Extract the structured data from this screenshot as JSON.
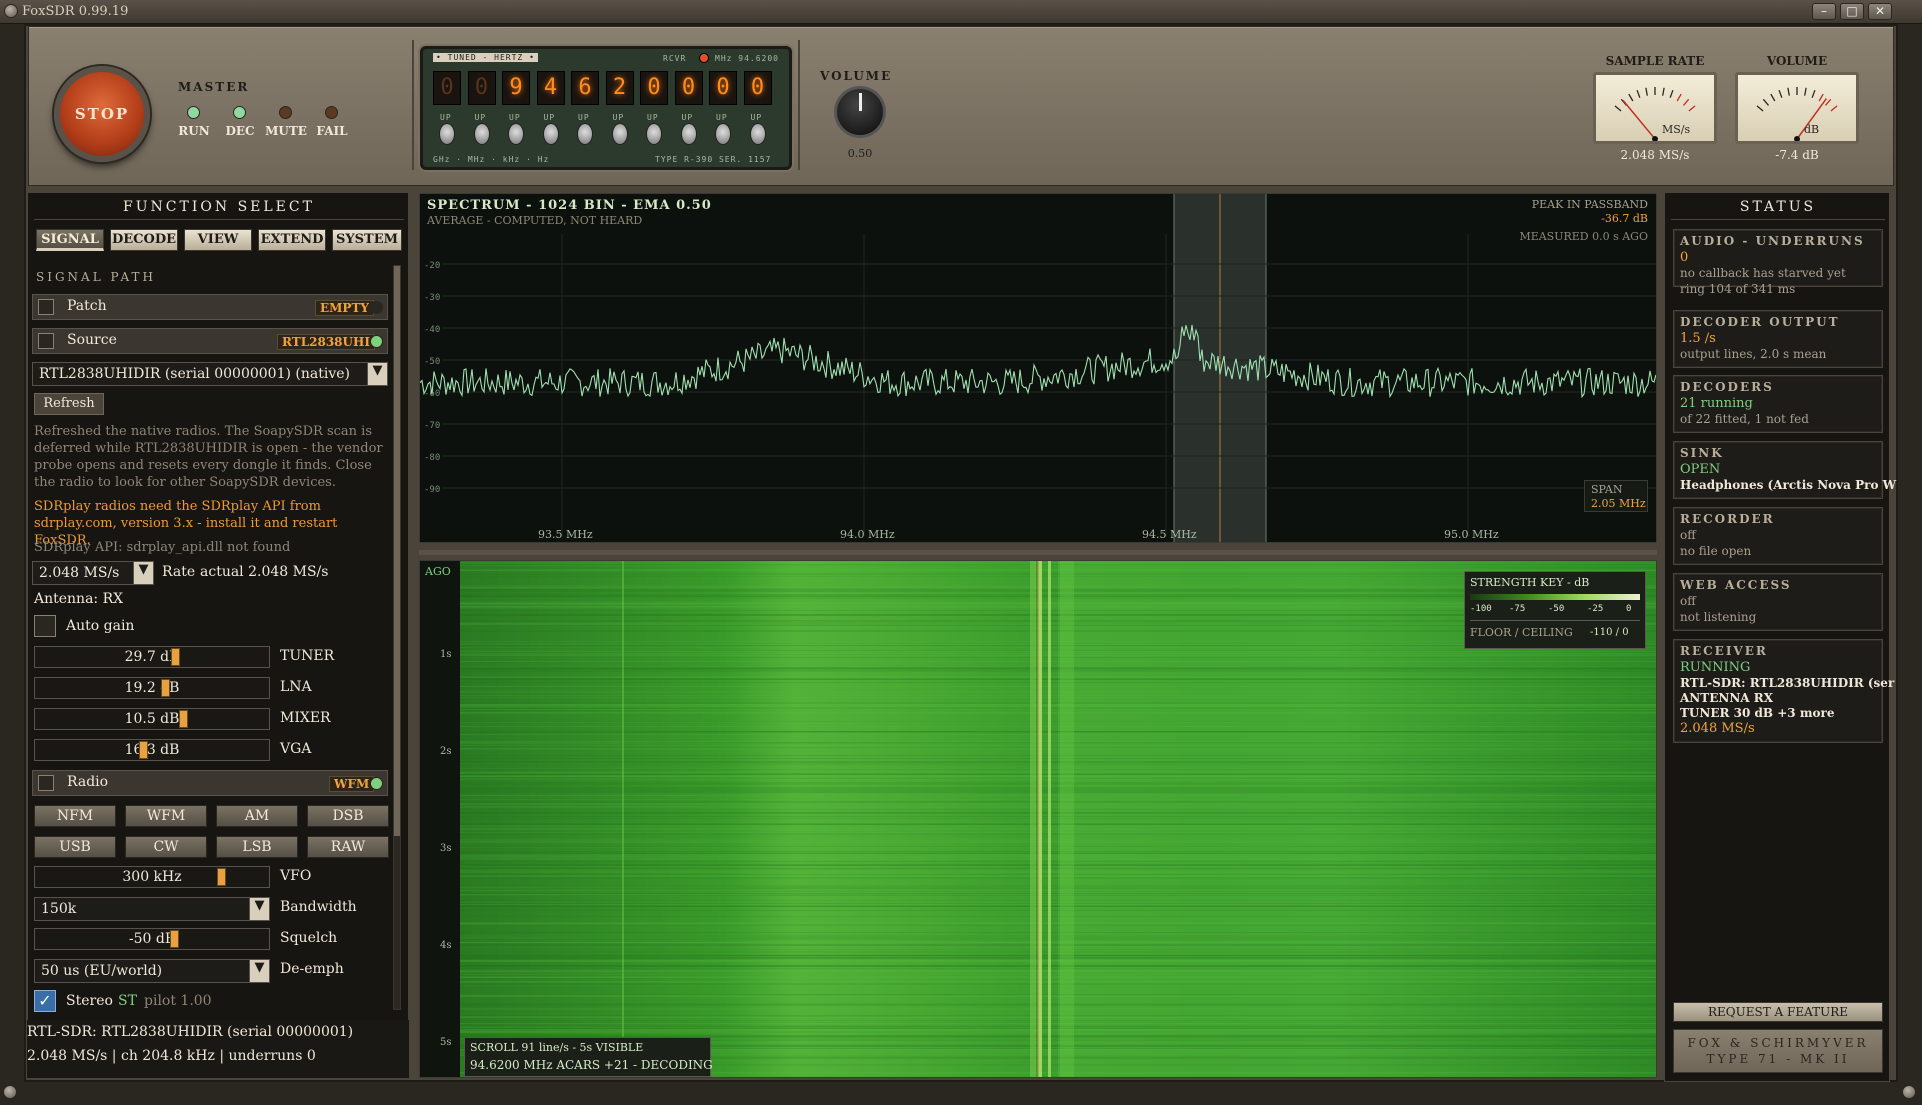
{
  "window": {
    "title": "FoxSDR 0.99.19"
  },
  "top": {
    "stop_label": "STOP",
    "master_label": "MASTER",
    "leds": [
      {
        "label": "RUN",
        "color": "#8fd8a0"
      },
      {
        "label": "DEC",
        "color": "#8fd8a0"
      },
      {
        "label": "MUTE",
        "color": "#5a3a20"
      },
      {
        "label": "FAIL",
        "color": "#5a3a20"
      }
    ],
    "freq": {
      "header_left": "• TUNED - HERTZ •",
      "header_right": "RCVR",
      "header_mhz": "MHz 94.6200",
      "digits": [
        "0",
        "0",
        "9",
        "4",
        "6",
        "2",
        "0",
        "0",
        "0",
        "0"
      ],
      "dim_count": 2,
      "toggle_label": "UP",
      "footer_left": "GHz · MHz · kHz · Hz",
      "footer_right": "TYPE R-390  SER. 1157"
    },
    "volume_knob": {
      "label": "VOLUME",
      "value": "0.50"
    },
    "meters": [
      {
        "title": "SAMPLE RATE",
        "unit": "MS/s",
        "value": "2.048 MS/s"
      },
      {
        "title": "VOLUME",
        "unit": "dB",
        "value": "-7.4 dB"
      }
    ]
  },
  "left": {
    "title": "FUNCTION SELECT",
    "tabs": [
      "SIGNAL",
      "DECODE",
      "VIEW",
      "EXTEND",
      "SYSTEM"
    ],
    "active_tab": 0,
    "signal_path_label": "SIGNAL PATH",
    "patch": {
      "label": "Patch",
      "tag": "EMPTY"
    },
    "source": {
      "label": "Source",
      "tag": "RTL2838UHI"
    },
    "device": "RTL2838UHIDIR (serial 00000001) (native)",
    "refresh_label": "Refresh",
    "note1": "Refreshed the native radios. The SoapySDR scan is deferred while RTL2838UHIDIR is open - the vendor probe opens and resets every dongle it finds. Close the radio to look for other SoapySDR devices.",
    "warn1": "SDRplay radios need the SDRplay API from sdrplay.com, version 3.x - install it and restart FoxSDR.",
    "note2": "SDRplay API: sdrplay_api.dll not found",
    "rate_value": "2.048 MS/s",
    "rate_label": "Rate",
    "rate_actual": "actual 2.048 MS/s",
    "antenna": "Antenna: RX",
    "auto_gain": "Auto gain",
    "gains": [
      {
        "value": "29.7 dB",
        "label": "TUNER",
        "level": 0.68
      },
      {
        "value": "19.2 dB",
        "label": "LNA",
        "level": 0.63
      },
      {
        "value": "10.5 dB",
        "label": "MIXER",
        "level": 0.72
      },
      {
        "value": "16.3 dB",
        "label": "VGA",
        "level": 0.52
      }
    ],
    "radio": {
      "label": "Radio",
      "tag": "WFM"
    },
    "modes": [
      "NFM",
      "WFM",
      "AM",
      "DSB",
      "USB",
      "CW",
      "LSB",
      "RAW"
    ],
    "vfo": {
      "value": "300 kHz",
      "label": "VFO",
      "level": 0.8
    },
    "bandwidth": {
      "value": "150k",
      "label": "Bandwidth"
    },
    "squelch": {
      "value": "-50 dB",
      "label": "Squelch",
      "level": 0.6
    },
    "deemph": {
      "value": "50 us (EU/world)",
      "label": "De-emph"
    },
    "stereo": {
      "label": "Stereo",
      "st": "ST",
      "pilot": "pilot 1.00"
    },
    "status_line1": "RTL-SDR: RTL2838UHIDIR (serial 00000001)",
    "status_line2": "2.048 MS/s | ch 204.8 kHz | underruns 0"
  },
  "spectrum": {
    "title": "SPECTRUM - 1024 BIN - EMA 0.50",
    "subtitle": "AVERAGE - COMPUTED, NOT HEARD",
    "peak_label": "PEAK IN PASSBAND",
    "peak_value": "-36.7 dB",
    "measured": "MEASURED 0.0 s AGO",
    "span_label": "SPAN",
    "span_value": "2.05 MHz",
    "y_ticks": [
      "-20",
      "-30",
      "-40",
      "-50",
      "-60",
      "-70",
      "-80",
      "-90"
    ],
    "x_ticks": [
      "93.5 MHz",
      "94.0 MHz",
      "94.5 MHz",
      "95.0 MHz"
    ]
  },
  "waterfall": {
    "ago_label": "AGO",
    "time_ticks": [
      "1s",
      "2s",
      "3s",
      "4s",
      "5s"
    ],
    "key_title": "STRENGTH KEY - dB",
    "key_ticks": [
      "-100",
      "-75",
      "-50",
      "-25",
      "0"
    ],
    "floor_label": "FLOOR / CEILING",
    "floor_value": "-110 / 0",
    "scroll_line": "SCROLL 91 line/s  -  5s VISIBLE",
    "decode_line": "94.6200 MHz ACARS +21 - DECODING"
  },
  "status": {
    "title": "STATUS",
    "cards": [
      {
        "h": "AUDIO - UNDERRUNS",
        "v": "0",
        "d1": "no callback has starved yet",
        "d2": "ring 104 of 341 ms"
      },
      {
        "h": "DECODER OUTPUT",
        "v": "1.5 /s",
        "d1": "output lines, 2.0 s mean"
      },
      {
        "h": "DECODERS",
        "g": "21 running",
        "d1": "of 22 fitted, 1 not fed"
      },
      {
        "h": "SINK",
        "g": "OPEN",
        "w1": "Headphones (Arctis Nova Pro W"
      },
      {
        "h": "RECORDER",
        "d0": "off",
        "d1": "no file open"
      },
      {
        "h": "WEB ACCESS",
        "d0": "off",
        "d1": "not listening"
      },
      {
        "h": "RECEIVER",
        "g": "RUNNING",
        "w1": "RTL-SDR: RTL2838UHIDIR (ser",
        "w2": "ANTENNA RX",
        "w3": "TUNER 30 dB +3 more",
        "v2": "2.048 MS/s"
      }
    ],
    "request_label": "REQUEST A FEATURE",
    "plate_line1": "FOX & SCHIRMYVER",
    "plate_line2": "TYPE 71 - MK II"
  },
  "colors": {
    "accent": "#f2a43a",
    "ok": "#7fd07f",
    "trace": "#9fe0b0",
    "waterfall": "#3a9a30"
  }
}
